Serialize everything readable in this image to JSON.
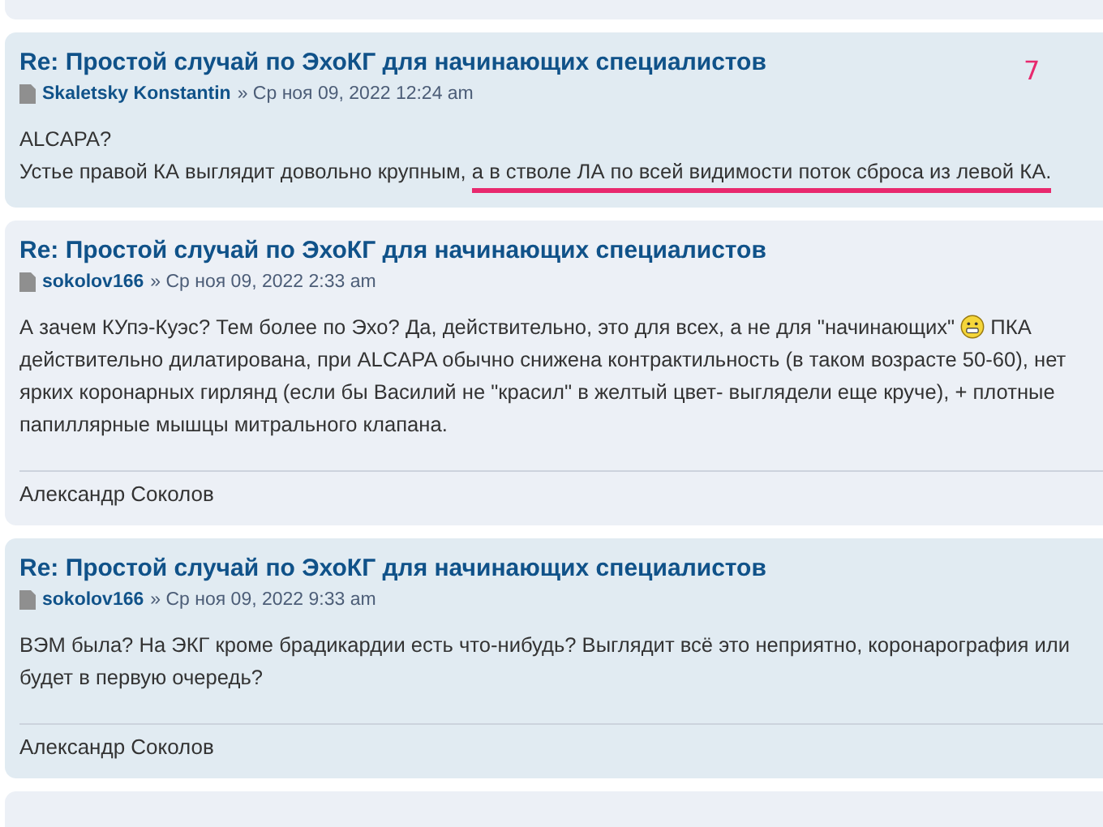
{
  "posts": [
    {
      "title": "Re: Простой случай по ЭхоКГ для начинающих специалистов",
      "author": "Skaletsky Konstantin",
      "date": "» Ср ноя 09, 2022 12:24 am",
      "kind": "bg2",
      "annotation": "7",
      "lines": [
        [
          {
            "kind": "text",
            "text": "ALCAPA?",
            "underlined": false
          }
        ],
        [
          {
            "kind": "text",
            "text": "Устье правой КА выглядит довольно крупным, ",
            "underlined": false
          },
          {
            "kind": "text",
            "text": "а в стволе ЛА по всей видимости поток сброса из левой КА.",
            "underlined": true
          }
        ]
      ]
    },
    {
      "title": "Re: Простой случай по ЭхоКГ для начинающих специалистов",
      "author": "sokolov166",
      "date": "» Ср ноя 09, 2022 2:33 am",
      "kind": "bg1",
      "signature": "Александр Соколов",
      "lines": [
        [
          {
            "kind": "text",
            "text": "А зачем КУпэ-Куэс? Тем более по Эхо? Да, действительно, это для всех, а не для \"начинающих\" ",
            "underlined": false
          },
          {
            "kind": "smiley"
          },
          {
            "kind": "text",
            "text": " ПКА",
            "underlined": false
          }
        ],
        [
          {
            "kind": "text",
            "text": "действительно дилатирована, при ALCAPA обычно снижена контрактильность (в таком возрасте 50-60), нет",
            "underlined": false
          }
        ],
        [
          {
            "kind": "text",
            "text": "ярких коронарных гирлянд (если бы Василий не \"красил\" в желтый цвет- выглядели еще круче), + плотные",
            "underlined": false
          }
        ],
        [
          {
            "kind": "text",
            "text": "папиллярные мышцы митрального клапана.",
            "underlined": false
          }
        ]
      ]
    },
    {
      "title": "Re: Простой случай по ЭхоКГ для начинающих специалистов",
      "author": "sokolov166",
      "date": "» Ср ноя 09, 2022 9:33 am",
      "kind": "bg2",
      "signature": "Александр Соколов",
      "lines": [
        [
          {
            "kind": "text",
            "text": "ВЭМ была? На ЭКГ кроме брадикардии есть что-нибудь? Выглядит всё это неприятно, коронарография или",
            "underlined": false
          }
        ],
        [
          {
            "kind": "text",
            "text": "будет в первую очередь?",
            "underlined": false
          }
        ]
      ]
    }
  ]
}
